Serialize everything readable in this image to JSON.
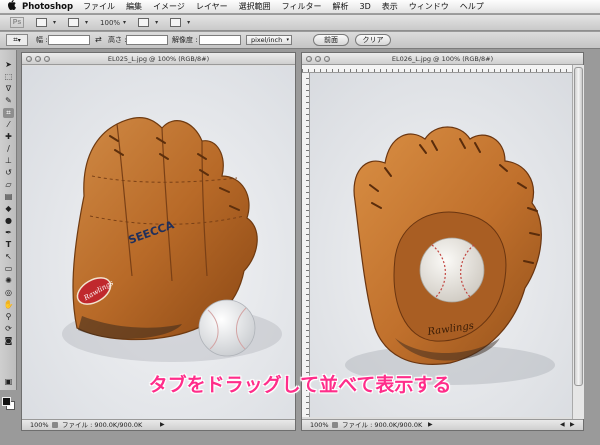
{
  "menubar": {
    "apple": "",
    "app_name": "Photoshop",
    "items": [
      "ファイル",
      "編集",
      "イメージ",
      "レイヤー",
      "選択範囲",
      "フィルター",
      "解析",
      "3D",
      "表示",
      "ウィンドウ",
      "ヘルプ"
    ]
  },
  "appbar": {
    "ps_logo": "Ps",
    "zoom": "100%"
  },
  "options": {
    "width_label": "幅 :",
    "width_value": "",
    "height_label": "高さ :",
    "height_value": "",
    "resolution_label": "解像度 :",
    "resolution_value": "",
    "unit_select": "pixel/inch",
    "front_button": "前面",
    "clear_button": "クリア"
  },
  "doc_left": {
    "title": "EL025_L.jpg @ 100% (RGB/8#)",
    "zoom": "100%",
    "file_info": "ファイル : 900.0K/900.0K"
  },
  "doc_right": {
    "title": "EL026_L.jpg @ 100% (RGB/8#)",
    "zoom": "100%",
    "file_info": "ファイル : 900.0K/900.0K"
  },
  "image_text": {
    "left_glove_brand": "SEECCA",
    "left_glove_logo": "Rawlings",
    "right_glove_logo": "Rawlings"
  },
  "caption": "タブをドラッグして並べて表示する",
  "colors": {
    "caption": "#ff2d8a",
    "glove": "#c0702c",
    "canvas_bg": "#e6e9ec"
  },
  "icons": [
    "apple-icon",
    "crop-tool-icon",
    "move-tool-icon",
    "marquee-tool-icon",
    "lasso-tool-icon"
  ]
}
